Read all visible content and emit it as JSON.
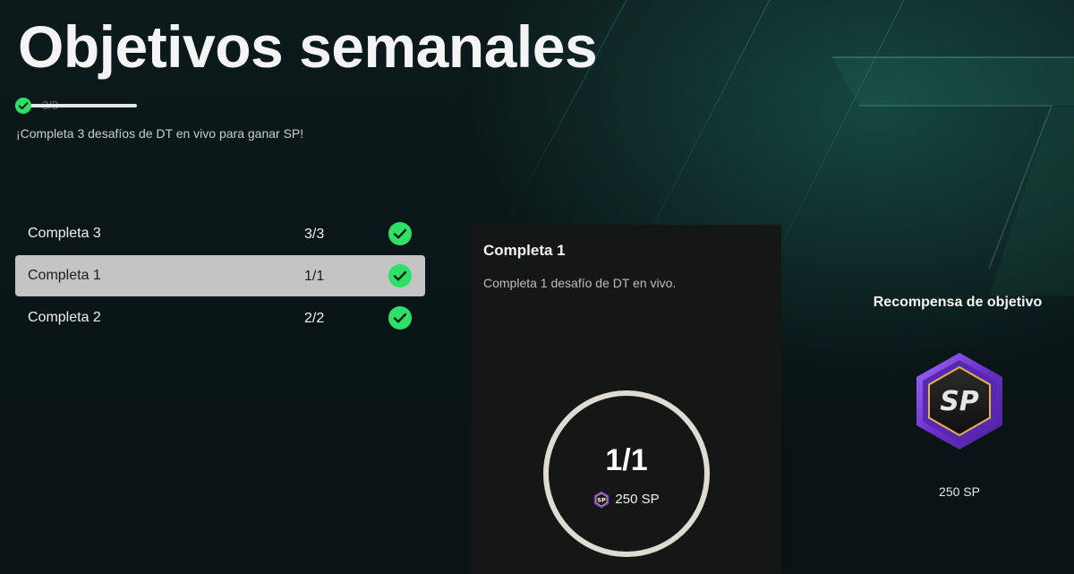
{
  "page": {
    "title": "Objetivos semanales",
    "overall_progress": "3/3",
    "overall_fraction": 1.0,
    "subtitle": "¡Completa 3 desafíos de DT en vivo para ganar SP!"
  },
  "objectives": [
    {
      "label": "Completa 3",
      "count": "3/3",
      "completed": true,
      "selected": false
    },
    {
      "label": "Completa 1",
      "count": "1/1",
      "completed": true,
      "selected": true
    },
    {
      "label": "Completa 2",
      "count": "2/2",
      "completed": true,
      "selected": false
    }
  ],
  "detail": {
    "title": "Completa 1",
    "description": "Completa 1 desafío de DT en vivo.",
    "progress": "1/1",
    "reward": "250 SP",
    "sp_icon_text": "SP"
  },
  "reward_panel": {
    "title": "Recompensa de objetivo",
    "badge_text": "SP",
    "amount": "250 SP"
  },
  "colors": {
    "check_green": "#2ee068",
    "selected_row": "#c4c4c4",
    "panel_bg": "#151616",
    "ring": "#dedbd2",
    "badge_purple": "#7b3fd6",
    "badge_gold": "#e2b34a"
  },
  "icons": {
    "check": "check-circle-icon",
    "sp": "sp-coin-icon",
    "badge": "sp-hexagon-badge-icon"
  }
}
